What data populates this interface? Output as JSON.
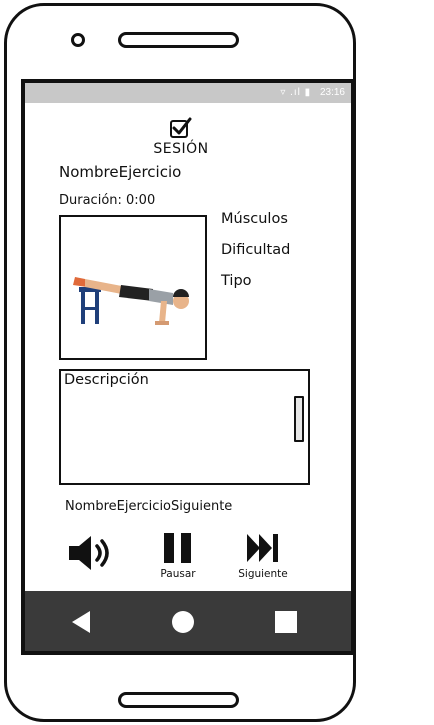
{
  "statusbar": {
    "icons": "▿ .ıl ▮",
    "time": "23:16"
  },
  "session": {
    "title": "SESIÓN"
  },
  "exercise": {
    "name": "NombreEjercicio",
    "duration_label": "Duración: 0:00",
    "image_alt": "push-up exercise illustration"
  },
  "attributes": [
    "Músculos",
    "Dificultad",
    "Tipo"
  ],
  "description": {
    "label": "Descripción"
  },
  "next_exercise": "NombreEjercicioSiguiente",
  "controls": {
    "volume_icon": "speaker-icon",
    "pause_label": "Pausar",
    "next_label": "Siguiente"
  },
  "colors": {
    "statusbar": "#c8c8c8",
    "navbar": "#3a3a3a",
    "ink": "#111111"
  }
}
